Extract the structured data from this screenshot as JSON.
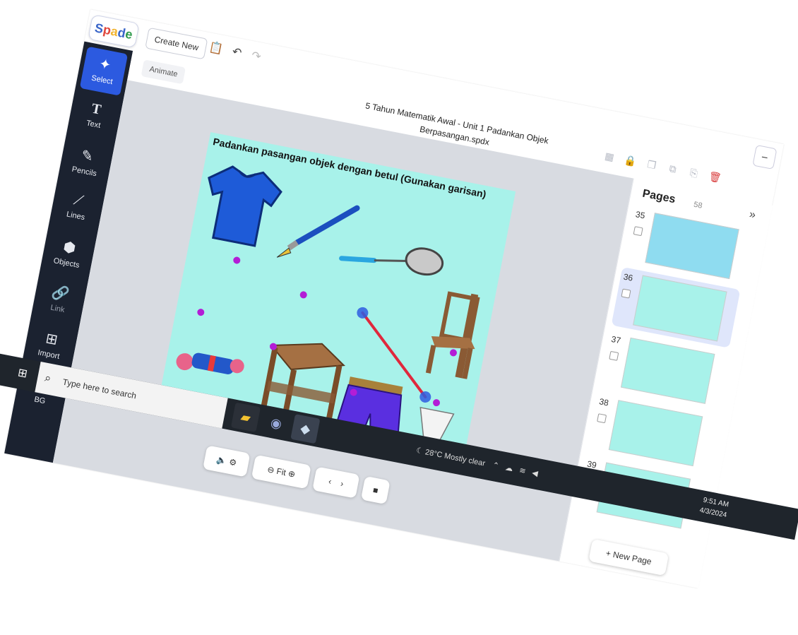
{
  "app": {
    "logo_text": "Spade",
    "create_new": "Create New",
    "animate": "Animate",
    "file_title_line1": "5 Tahun Matematik Awal - Unit 1 Padankan Objek",
    "file_title_line2": "Berpasangan.spdx",
    "minimize": "–"
  },
  "tools": [
    {
      "label": "Select",
      "icon": "cursor-icon"
    },
    {
      "label": "Text",
      "icon": "text-icon"
    },
    {
      "label": "Pencils",
      "icon": "pencil-icon"
    },
    {
      "label": "Lines",
      "icon": "line-icon"
    },
    {
      "label": "Objects",
      "icon": "cube-icon"
    },
    {
      "label": "Link",
      "icon": "link-icon"
    },
    {
      "label": "Import",
      "icon": "import-icon"
    },
    {
      "label": "BG",
      "icon": "hatch-icon"
    }
  ],
  "slide": {
    "title": "Padankan pasangan objek dengan betul (Gunakan garisan)",
    "bg_color": "#a8f2ea",
    "dot_color": "#b31dd6",
    "line_color": "#e0283c"
  },
  "controls": {
    "fit_label": "Fit",
    "prev": "‹",
    "next": "›"
  },
  "pages": {
    "title": "Pages",
    "count": "58",
    "items": [
      {
        "num": "35"
      },
      {
        "num": "36"
      },
      {
        "num": "37"
      },
      {
        "num": "38"
      },
      {
        "num": "39"
      }
    ],
    "new_page": "New Page"
  },
  "taskbar": {
    "search_placeholder": "Type here to search",
    "weather": "28°C  Mostly clear",
    "time": "9:51 AM",
    "date": "4/3/2024"
  }
}
